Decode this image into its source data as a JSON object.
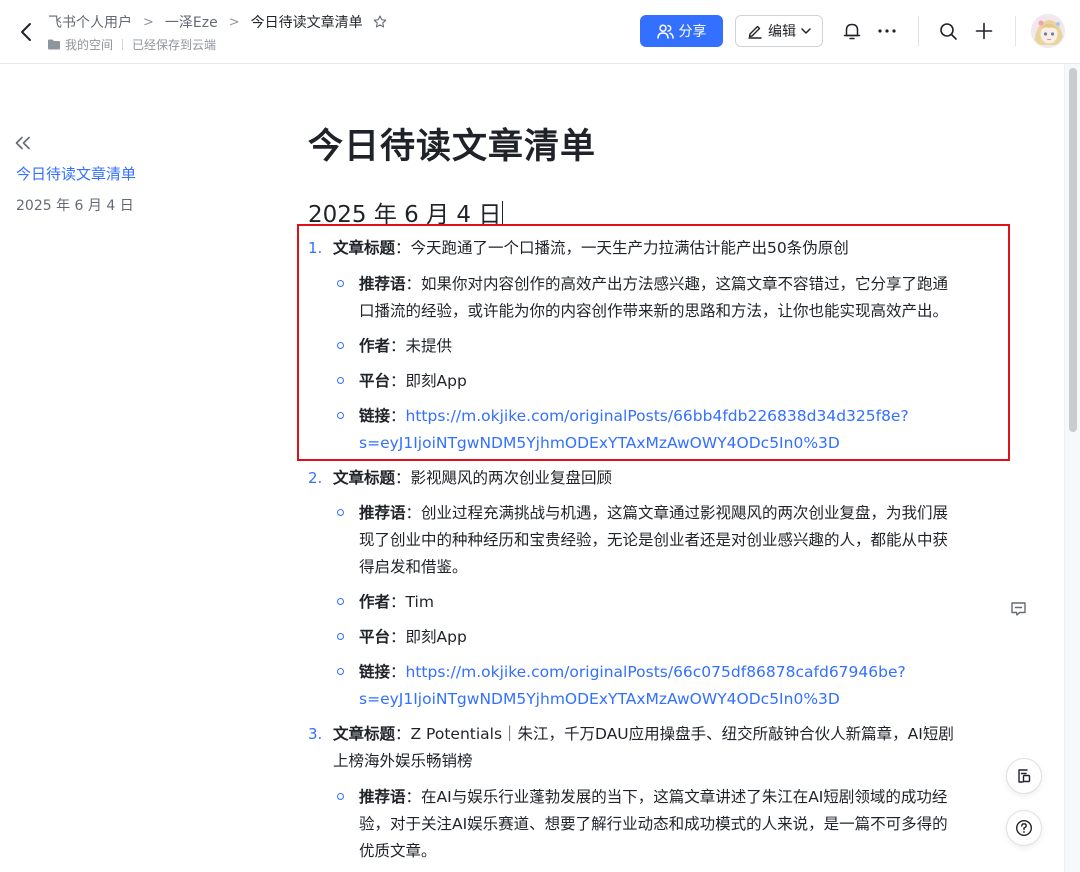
{
  "header": {
    "breadcrumbs": [
      "飞书个人用户",
      "一泽Eze",
      "今日待读文章清单"
    ],
    "space_label": "我的空间",
    "save_status": "已经保存到云端",
    "share_label": "分享",
    "edit_label": "编辑"
  },
  "colors": {
    "accent": "#3370ff",
    "highlight": "#e0101a",
    "text": "#1f2329"
  },
  "outline": {
    "items": [
      "今日待读文章清单",
      "2025 年 6 月 4 日"
    ]
  },
  "document": {
    "title": "今日待读文章清单",
    "date_heading": "2025 年 6 月 4 日",
    "labels": {
      "title": "文章标题",
      "recommend": "推荐语",
      "author": "作者",
      "platform": "平台",
      "link": "链接"
    },
    "articles": [
      {
        "number": "1.",
        "title_lines": [
          "：今天跑通了一个口播流，一天生产力拉满估计能产出50条伪原创"
        ],
        "recommend_lines": [
          "：如果你对内容创作的高效产出方法感兴趣，这篇文章不容错过，它分享了跑通",
          "口播流的经验，或许能为你的内容创作带来新的思路和方法，让你也能实现高效产出。"
        ],
        "author": "：未提供",
        "platform": "：即刻App",
        "link_lines": [
          "https://m.okjike.com/originalPosts/66bb4fdb226838d34d325f8e?",
          "s=eyJ1IjoiNTgwNDM5YjhmODExYTAxMzAwOWY4ODc5In0%3D"
        ]
      },
      {
        "number": "2.",
        "title_lines": [
          "：影视飓风的两次创业复盘回顾"
        ],
        "recommend_lines": [
          "：创业过程充满挑战与机遇，这篇文章通过影视飓风的两次创业复盘，为我们展",
          "现了创业中的种种经历和宝贵经验，无论是创业者还是对创业感兴趣的人，都能从中获",
          "得启发和借鉴。"
        ],
        "author": "：Tim",
        "platform": "：即刻App",
        "link_lines": [
          "https://m.okjike.com/originalPosts/66c075df86878cafd67946be?",
          "s=eyJ1IjoiNTgwNDM5YjhmODExYTAxMzAwOWY4ODc5In0%3D"
        ]
      },
      {
        "number": "3.",
        "title_lines": [
          "：Z Potentials｜朱江，千万DAU应用操盘手、纽交所敲钟合伙人新篇章，AI短剧",
          "上榜海外娱乐畅销榜"
        ],
        "recommend_lines": [
          "：在AI与娱乐行业蓬勃发展的当下，这篇文章讲述了朱江在AI短剧领域的成功经",
          "验，对于关注AI娱乐赛道、想要了解行业动态和成功模式的人来说，是一篇不可多得的",
          "优质文章。"
        ]
      }
    ]
  }
}
